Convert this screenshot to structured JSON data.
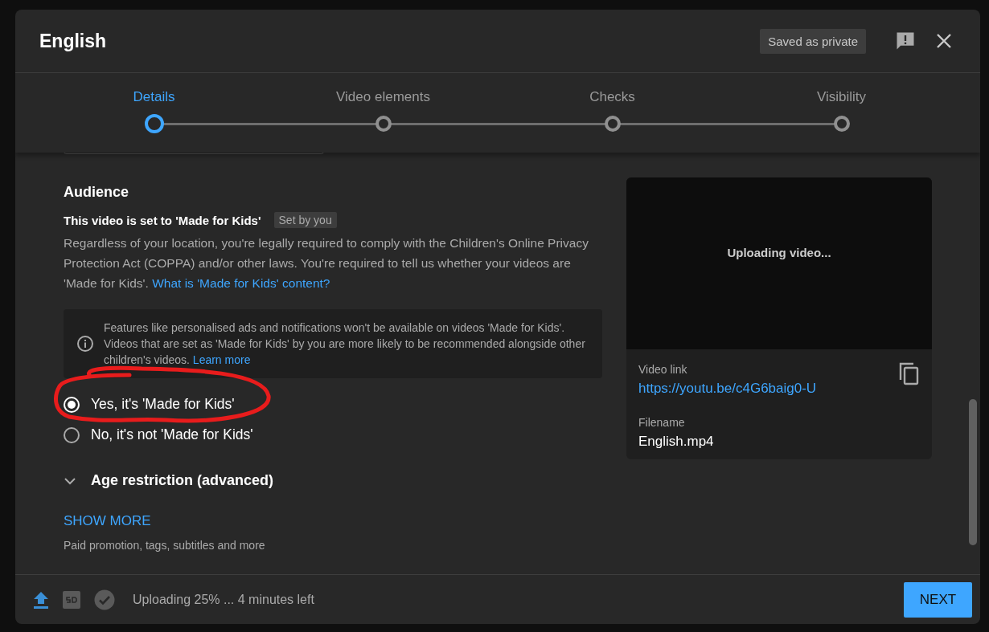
{
  "dialog": {
    "title": "English",
    "status_chip": "Saved as private"
  },
  "steps": [
    {
      "label": "Details",
      "selected": true
    },
    {
      "label": "Video elements",
      "selected": false
    },
    {
      "label": "Checks",
      "selected": false
    },
    {
      "label": "Visibility",
      "selected": false
    }
  ],
  "audience": {
    "heading": "Audience",
    "setting": "This video is set to 'Made for Kids'",
    "setting_chip": "Set by you",
    "description": "Regardless of your location, you're legally required to comply with the Children's Online Privacy Protection Act (COPPA) and/or other laws. You're required to tell us whether your videos are 'Made for Kids'.",
    "description_link": "What is 'Made for Kids' content?",
    "notice": "Features like personalised ads and notifications won't be available on videos 'Made for Kids'. Videos that are set as 'Made for Kids' by you are more likely to be recommended alongside other children's videos.",
    "notice_link": "Learn more",
    "options": [
      {
        "label": "Yes, it's 'Made for Kids'",
        "selected": true
      },
      {
        "label": "No, it's not 'Made for Kids'",
        "selected": false
      }
    ]
  },
  "age_restriction": {
    "label": "Age restriction (advanced)",
    "expanded": false
  },
  "show_more": {
    "label": "SHOW MORE",
    "caption": "Paid promotion, tags, subtitles and more"
  },
  "preview": {
    "status": "Uploading video...",
    "link_label": "Video link",
    "link": "https://youtu.be/c4G6baig0-U",
    "filename_label": "Filename",
    "filename": "English.mp4"
  },
  "footer": {
    "progress": "Uploading 25% ... 4 minutes left",
    "next": "NEXT"
  }
}
